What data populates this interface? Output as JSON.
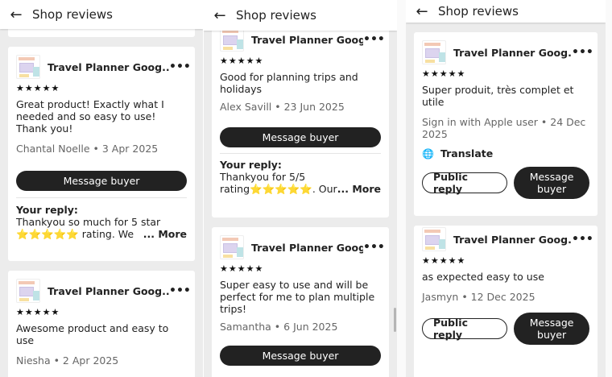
{
  "app": {
    "title": "Shop reviews",
    "back_glyph": "←"
  },
  "product_name": "Travel Planner Goog...",
  "stars": "★★★★★",
  "more_dots": "•••",
  "message_buyer": "Message buyer",
  "public_reply": "Public reply",
  "translate_label": "Translate",
  "your_reply_label": "Your reply:",
  "more_label": "... More",
  "panel1": {
    "review1": {
      "text": "Great product! Exactly what I needed and so easy to use! Thank you!",
      "meta": "Chantal Noelle • 3 Apr 2025",
      "reply": "Thankyou so much for 5 star ⭐⭐⭐⭐⭐ rating. We"
    },
    "review2": {
      "text": "Awesome product and easy to use",
      "meta": "Niesha • 2 Apr 2025"
    }
  },
  "panel2": {
    "review1": {
      "text": "Good for planning trips and holidays",
      "meta": "Alex Savill • 23 Jun 2025",
      "reply": "Thankyou for 5/5 rating⭐⭐⭐⭐⭐. Our"
    },
    "review2": {
      "text": "Super easy to use and will be perfect for me to plan multiple trips!",
      "meta": "Samantha • 6 Jun 2025"
    }
  },
  "panel3": {
    "review1": {
      "text": "Super produit, très complet et utile",
      "meta": "Sign in with Apple user • 24 Dec 2025"
    },
    "review2": {
      "text": "as expected easy to use",
      "meta": "Jasmyn • 12 Dec 2025"
    }
  },
  "colors": {
    "button_dark": "#222222",
    "background": "#ececec",
    "star": "#f1c40f"
  }
}
